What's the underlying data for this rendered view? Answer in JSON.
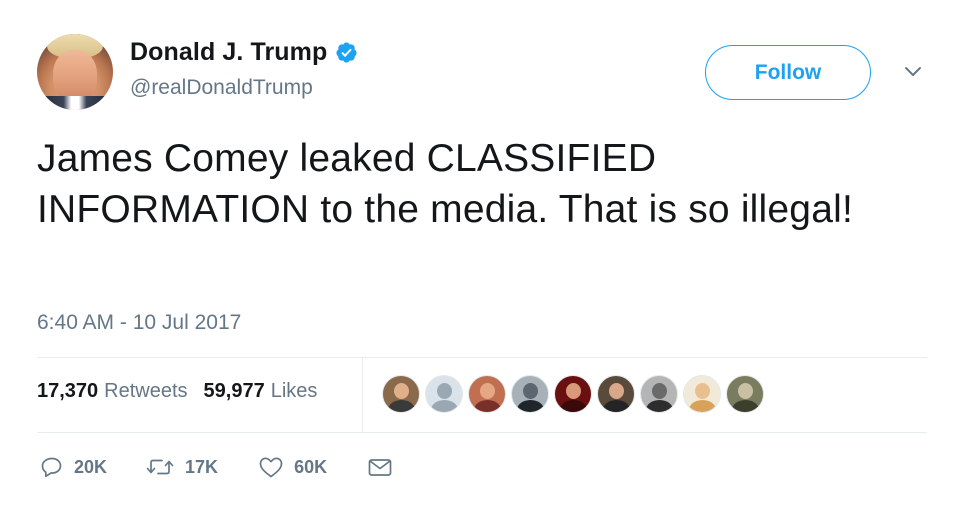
{
  "author": {
    "display_name": "Donald J. Trump",
    "handle": "@realDonaldTrump",
    "verified": true
  },
  "header": {
    "follow_label": "Follow"
  },
  "tweet": {
    "text": "James Comey leaked CLASSIFIED INFORMATION to the media. That is so illegal!",
    "timestamp": "6:40 AM - 10 Jul 2017"
  },
  "stats": {
    "retweets_count": "17,370",
    "retweets_label": "Retweets",
    "likes_count": "59,977",
    "likes_label": "Likes"
  },
  "likers": [
    {
      "name": "liker-1",
      "bg": "#8a6a4a",
      "head": "#e0b08a",
      "body": "#3a3a3a"
    },
    {
      "name": "liker-2",
      "bg": "#dbe3ea",
      "head": "#9aa8b4",
      "body": "#9aa8b4"
    },
    {
      "name": "liker-3",
      "bg": "#c07050",
      "head": "#e6a785",
      "body": "#7a2f2a"
    },
    {
      "name": "liker-4",
      "bg": "#a8b0b8",
      "head": "#5b6670",
      "body": "#1f252b"
    },
    {
      "name": "liker-5",
      "bg": "#6b1010",
      "head": "#d99a7a",
      "body": "#3a0a0a"
    },
    {
      "name": "liker-6",
      "bg": "#5a4a3c",
      "head": "#d8a889",
      "body": "#242424"
    },
    {
      "name": "liker-7",
      "bg": "#b5b5b5",
      "head": "#6a6a6a",
      "body": "#2d2d2d"
    },
    {
      "name": "liker-8",
      "bg": "#f2ead8",
      "head": "#e8c090",
      "body": "#d8a25a"
    },
    {
      "name": "liker-9",
      "bg": "#7a7c60",
      "head": "#c9c0a3",
      "body": "#3c3f2c"
    }
  ],
  "actions": {
    "reply_count": "20K",
    "retweet_count": "17K",
    "like_count": "60K"
  },
  "colors": {
    "accent": "#1da1f2",
    "muted": "#657786",
    "text": "#14171a",
    "divider": "#e6ecf0"
  },
  "icons": {
    "verified": "verified-badge-icon",
    "caret": "chevron-down-icon",
    "reply": "reply-icon",
    "retweet": "retweet-icon",
    "like": "heart-icon",
    "dm": "envelope-icon"
  }
}
